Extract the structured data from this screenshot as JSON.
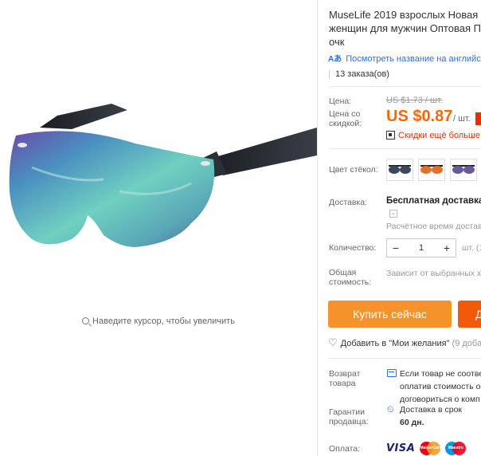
{
  "product": {
    "image_zoom_hint": "Наведите курсор, чтобы увеличить",
    "title": "MuseLife 2019 взрослых Новая м\nженщин для мужчин Оптовая П\nочк",
    "translate_link": "Посмотреть название на английск",
    "translate_icon": "translate-icon",
    "orders": "13 заказа(ов)"
  },
  "price": {
    "label": "Цена:",
    "old": "US $1.73 / шт.",
    "discount_label": "Цена со скидкой:",
    "new": "US $0.87",
    "unit": "/ шт.",
    "more_discounts": "Скидки ещё больше",
    "accent_color": "#ff6600"
  },
  "options": {
    "lens_color_label": "Цвет стёкол:",
    "lens_colors": [
      "grey",
      "orange",
      "purple"
    ]
  },
  "shipping": {
    "label": "Доставка:",
    "value": "Бесплатная доставка в",
    "estimate": "Расчётное время достав"
  },
  "quantity": {
    "label": "Количество:",
    "value": "1",
    "minus": "−",
    "plus": "+",
    "unit": "шт. (1"
  },
  "total": {
    "label": "Общая стоимость:",
    "value": "Зависит от выбранных х"
  },
  "actions": {
    "buy_now": "Купить сейчас",
    "add_to_cart": "Д",
    "wishlist": "Добавить в \"Мои желания\"",
    "wishlist_count": "(9 доба"
  },
  "returns": {
    "label": "Возврат товара",
    "lines": [
      "Если товар не соотве",
      "оплатив стоимость об",
      "договориться о комп"
    ]
  },
  "guarantee": {
    "label": "Гарантии продавца:",
    "line1": "Доставка в срок",
    "line2": "60 дн."
  },
  "payment": {
    "label": "Оплата:",
    "visa": "VISA",
    "mastercard": "MasterCard",
    "maestro": "Maestro"
  }
}
